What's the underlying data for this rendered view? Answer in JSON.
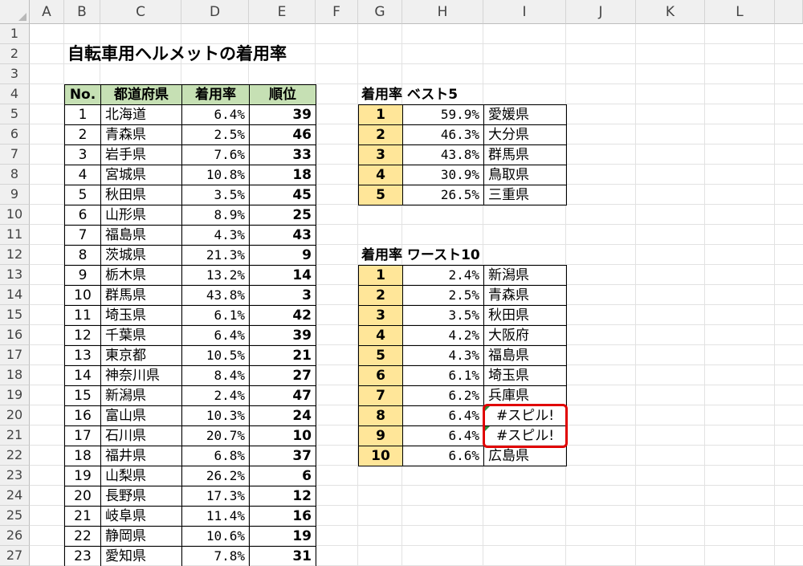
{
  "grid": {
    "columns": [
      "A",
      "B",
      "C",
      "D",
      "E",
      "F",
      "G",
      "H",
      "I",
      "J",
      "K",
      "L"
    ],
    "rows": [
      "1",
      "2",
      "3",
      "4",
      "5",
      "6",
      "7",
      "8",
      "9",
      "10",
      "11",
      "12",
      "13",
      "14",
      "15",
      "16",
      "17",
      "18",
      "19",
      "20",
      "21",
      "22",
      "23",
      "24",
      "25",
      "26",
      "27"
    ]
  },
  "title": "自転車用ヘルメットの着用率",
  "main_table": {
    "headers": [
      "No.",
      "都道府県",
      "着用率",
      "順位"
    ],
    "rows": [
      [
        "1",
        "北海道",
        "6.4%",
        "39"
      ],
      [
        "2",
        "青森県",
        "2.5%",
        "46"
      ],
      [
        "3",
        "岩手県",
        "7.6%",
        "33"
      ],
      [
        "4",
        "宮城県",
        "10.8%",
        "18"
      ],
      [
        "5",
        "秋田県",
        "3.5%",
        "45"
      ],
      [
        "6",
        "山形県",
        "8.9%",
        "25"
      ],
      [
        "7",
        "福島県",
        "4.3%",
        "43"
      ],
      [
        "8",
        "茨城県",
        "21.3%",
        "9"
      ],
      [
        "9",
        "栃木県",
        "13.2%",
        "14"
      ],
      [
        "10",
        "群馬県",
        "43.8%",
        "3"
      ],
      [
        "11",
        "埼玉県",
        "6.1%",
        "42"
      ],
      [
        "12",
        "千葉県",
        "6.4%",
        "39"
      ],
      [
        "13",
        "東京都",
        "10.5%",
        "21"
      ],
      [
        "14",
        "神奈川県",
        "8.4%",
        "27"
      ],
      [
        "15",
        "新潟県",
        "2.4%",
        "47"
      ],
      [
        "16",
        "富山県",
        "10.3%",
        "24"
      ],
      [
        "17",
        "石川県",
        "20.7%",
        "10"
      ],
      [
        "18",
        "福井県",
        "6.8%",
        "37"
      ],
      [
        "19",
        "山梨県",
        "26.2%",
        "6"
      ],
      [
        "20",
        "長野県",
        "17.3%",
        "12"
      ],
      [
        "21",
        "岐阜県",
        "11.4%",
        "16"
      ],
      [
        "22",
        "静岡県",
        "10.6%",
        "19"
      ],
      [
        "23",
        "愛知県",
        "7.8%",
        "31"
      ]
    ]
  },
  "best5": {
    "title": "着用率 ベスト5",
    "rows": [
      [
        "1",
        "59.9%",
        "愛媛県"
      ],
      [
        "2",
        "46.3%",
        "大分県"
      ],
      [
        "3",
        "43.8%",
        "群馬県"
      ],
      [
        "4",
        "30.9%",
        "鳥取県"
      ],
      [
        "5",
        "26.5%",
        "三重県"
      ]
    ]
  },
  "worst10": {
    "title": "着用率 ワースト10",
    "rows": [
      [
        "1",
        "2.4%",
        "新潟県"
      ],
      [
        "2",
        "2.5%",
        "青森県"
      ],
      [
        "3",
        "3.5%",
        "秋田県"
      ],
      [
        "4",
        "4.2%",
        "大阪府"
      ],
      [
        "5",
        "4.3%",
        "福島県"
      ],
      [
        "6",
        "6.1%",
        "埼玉県"
      ],
      [
        "7",
        "6.2%",
        "兵庫県"
      ],
      [
        "8",
        "6.4%",
        "#スピル!"
      ],
      [
        "9",
        "6.4%",
        "#スピル!"
      ],
      [
        "10",
        "6.6%",
        "広島県"
      ]
    ]
  },
  "colors": {
    "header_fill": "#c6e0b4",
    "rank_fill": "#ffe699",
    "highlight_border": "#e00000",
    "error_indicator": "#2e8b3e"
  }
}
